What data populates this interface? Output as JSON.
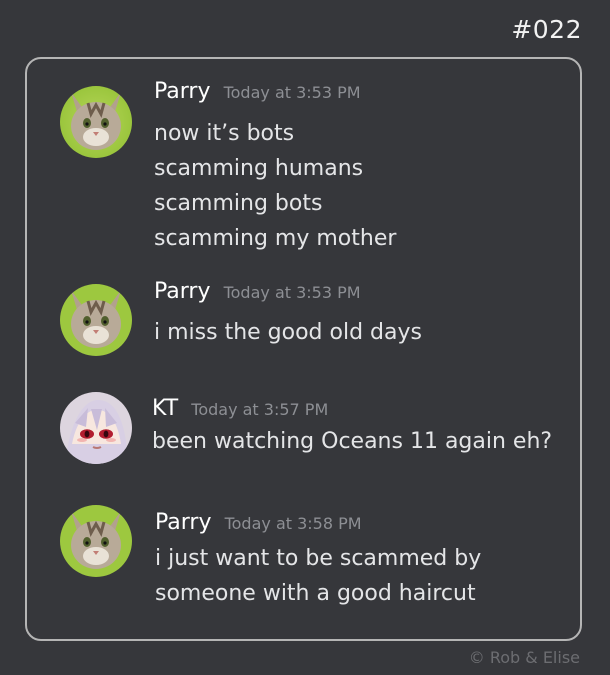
{
  "comic": {
    "number": "#022",
    "credit": "©  Rob & Elise"
  },
  "messages": [
    {
      "author": "Parry",
      "timestamp": "Today at 3:53 PM",
      "lines": [
        "now it’s bots",
        "scamming humans",
        "scamming bots",
        "scamming my mother"
      ],
      "avatar_icon": "cat-avatar-icon"
    },
    {
      "author": "Parry",
      "timestamp": "Today at 3:53 PM",
      "lines": [
        "i miss the good old days"
      ],
      "avatar_icon": "cat-avatar-icon"
    },
    {
      "author": "KT",
      "timestamp": "Today at 3:57 PM",
      "lines": [
        "been watching Oceans 11 again eh?"
      ],
      "avatar_icon": "anime-girl-avatar-icon"
    },
    {
      "author": "Parry",
      "timestamp": "Today at 3:58 PM",
      "lines": [
        "i just want to be scammed by",
        "someone with a good haircut"
      ],
      "avatar_icon": "cat-avatar-icon"
    }
  ],
  "colors": {
    "background": "#36373b",
    "frame_border": "#b5b5b5",
    "username": "#ffffff",
    "timestamp": "#8d8f94",
    "message_text": "#e4e5e7"
  }
}
